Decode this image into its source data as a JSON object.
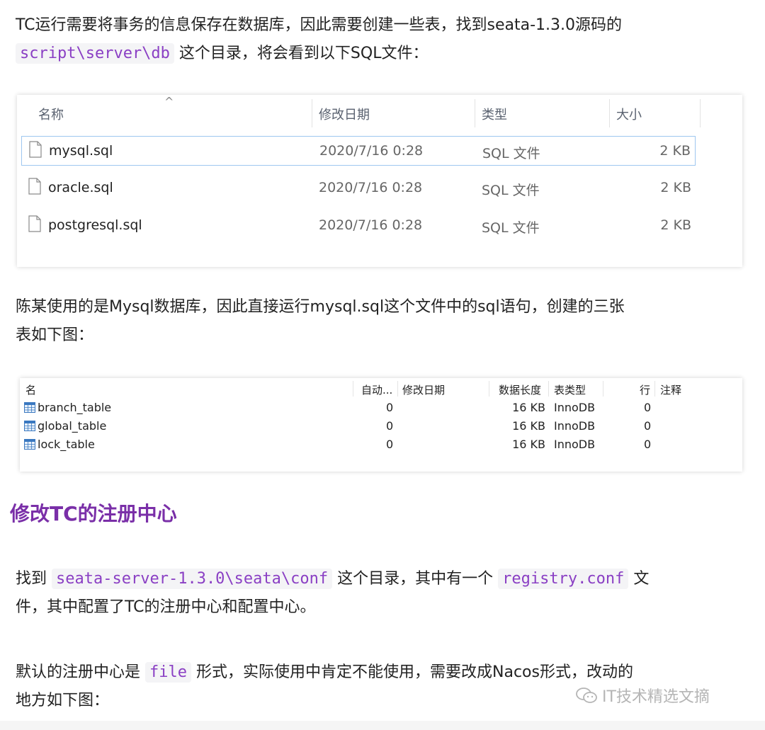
{
  "p1": {
    "line1": "TC运行需要将事务的信息保存在数据库，因此需要创建一些表，找到seata-1.3.0源码的",
    "code": "script\\server\\db",
    "line2": "这个目录，将会看到以下SQL文件："
  },
  "explorer": {
    "headers": {
      "name": "名称",
      "date": "修改日期",
      "type": "类型",
      "size": "大小"
    },
    "rows": [
      {
        "name": "mysql.sql",
        "date": "2020/7/16 0:28",
        "type": "SQL 文件",
        "size": "2 KB"
      },
      {
        "name": "oracle.sql",
        "date": "2020/7/16 0:28",
        "type": "SQL 文件",
        "size": "2 KB"
      },
      {
        "name": "postgresql.sql",
        "date": "2020/7/16 0:28",
        "type": "SQL 文件",
        "size": "2 KB"
      }
    ]
  },
  "p2": {
    "line1": "陈某使用的是Mysql数据库，因此直接运行mysql.sql这个文件中的sql语句，创建的三张",
    "line2": "表如下图："
  },
  "navicat": {
    "headers": {
      "name": "名",
      "auto": "自动...",
      "date": "修改日期",
      "len": "数据长度",
      "type": "表类型",
      "rows": "行",
      "comment": "注释"
    },
    "rows": [
      {
        "name": "branch_table",
        "auto": "0",
        "len": "16 KB",
        "type": "InnoDB",
        "rows": "0"
      },
      {
        "name": "global_table",
        "auto": "0",
        "len": "16 KB",
        "type": "InnoDB",
        "rows": "0"
      },
      {
        "name": "lock_table",
        "auto": "0",
        "len": "16 KB",
        "type": "InnoDB",
        "rows": "0"
      }
    ]
  },
  "h2": "修改TC的注册中心",
  "p3": {
    "pre": "找到",
    "code1": "seata-server-1.3.0\\seata\\conf",
    "mid": "这个目录，其中有一个",
    "code2": "registry.conf",
    "post": "文",
    "line2": "件，其中配置了TC的注册中心和配置中心。"
  },
  "p4": {
    "pre": "默认的注册中心是",
    "code": "file",
    "post": "形式，实际使用中肯定不能使用，需要改成Nacos形式，改动的",
    "line2": "地方如下图："
  },
  "watermark": "IT技术精选文摘"
}
